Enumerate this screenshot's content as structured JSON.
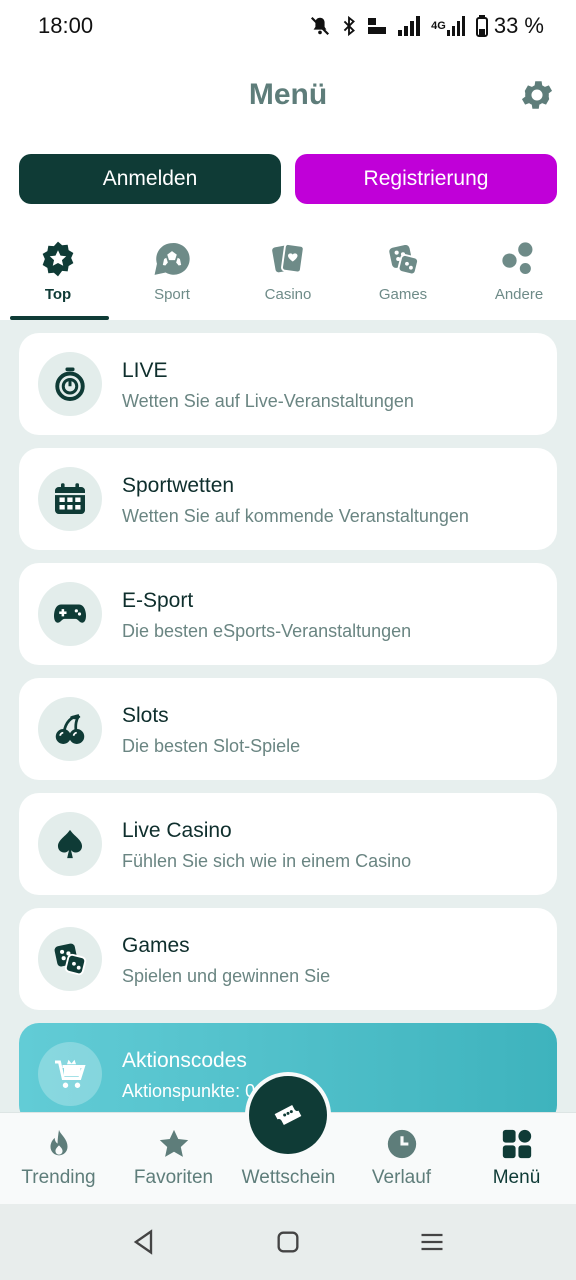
{
  "status_bar": {
    "time": "18:00",
    "network_label": "4G",
    "battery_percent": "33 %"
  },
  "header": {
    "title": "Menü"
  },
  "auth": {
    "login_label": "Anmelden",
    "register_label": "Registrierung"
  },
  "tabs": [
    {
      "label": "Top",
      "icon": "star-badge-icon",
      "active": true
    },
    {
      "label": "Sport",
      "icon": "soccer-ball-icon"
    },
    {
      "label": "Casino",
      "icon": "playing-cards-icon"
    },
    {
      "label": "Games",
      "icon": "dice-icon"
    },
    {
      "label": "Andere",
      "icon": "bubbles-icon"
    }
  ],
  "menu_items": [
    {
      "title": "LIVE",
      "subtitle": "Wetten Sie auf Live-Veranstaltungen",
      "icon": "stopwatch-icon"
    },
    {
      "title": "Sportwetten",
      "subtitle": "Wetten Sie auf kommende Veranstaltungen",
      "icon": "calendar-icon"
    },
    {
      "title": "E-Sport",
      "subtitle": "Die besten eSports-Veranstaltungen",
      "icon": "gamepad-icon"
    },
    {
      "title": "Slots",
      "subtitle": "Die besten Slot-Spiele",
      "icon": "cherries-icon"
    },
    {
      "title": "Live Casino",
      "subtitle": "Fühlen Sie sich wie in einem Casino",
      "icon": "spade-icon"
    },
    {
      "title": "Games",
      "subtitle": "Spielen und gewinnen Sie",
      "icon": "dice-icon"
    },
    {
      "title": "Aktionscodes",
      "subtitle": "Aktionspunkte: 0",
      "icon": "shopping-cart-icon"
    }
  ],
  "bottom_nav": [
    {
      "label": "Trending",
      "icon": "flame-icon"
    },
    {
      "label": "Favoriten",
      "icon": "star-icon"
    },
    {
      "label": "Wettschein",
      "icon": "ticket-icon"
    },
    {
      "label": "Verlauf",
      "icon": "clock-icon"
    },
    {
      "label": "Menü",
      "icon": "grid-icon",
      "active": true
    }
  ],
  "colors": {
    "primary_dark": "#0f3b36",
    "register": "#c000d8",
    "promo_gradient_start": "#62ccd6",
    "promo_gradient_end": "#3eb3bd",
    "muted_text": "#5e7d7a",
    "list_background": "#e7efee"
  }
}
